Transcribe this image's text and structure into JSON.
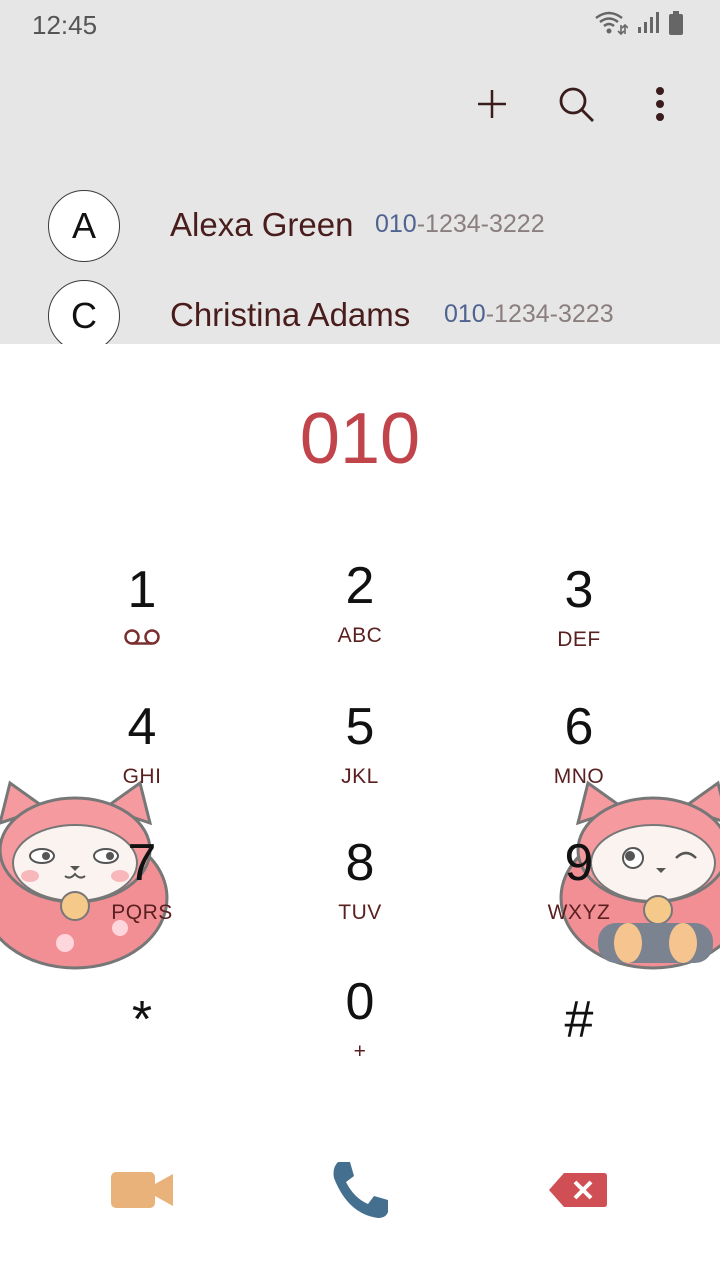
{
  "status_bar": {
    "time": "12:45"
  },
  "contacts": [
    {
      "initial": "A",
      "name": "Alexa Green",
      "number_match": "010",
      "number_rest": "-1234-3222"
    },
    {
      "initial": "C",
      "name": "Christina Adams",
      "number_match": "010",
      "number_rest": "-1234-3223"
    }
  ],
  "dialed_number": "010",
  "keypad": [
    {
      "digit": "1",
      "letters": ""
    },
    {
      "digit": "2",
      "letters": "ABC"
    },
    {
      "digit": "3",
      "letters": "DEF"
    },
    {
      "digit": "4",
      "letters": "GHI"
    },
    {
      "digit": "5",
      "letters": "JKL"
    },
    {
      "digit": "6",
      "letters": "MNO"
    },
    {
      "digit": "7",
      "letters": "PQRS"
    },
    {
      "digit": "8",
      "letters": "TUV"
    },
    {
      "digit": "9",
      "letters": "WXYZ"
    },
    {
      "digit": "*",
      "letters": ""
    },
    {
      "digit": "0",
      "letters": "+"
    },
    {
      "digit": "#",
      "letters": ""
    }
  ],
  "icons": {
    "actions": [
      "add-icon",
      "search-icon",
      "more-options-icon"
    ],
    "voicemail": "voicemail-icon",
    "bottom": [
      "video-call-icon",
      "phone-call-icon",
      "backspace-icon"
    ]
  },
  "colors": {
    "dialed_number": "#c0444a",
    "number_match": "#4e6390",
    "video": "#e8b27a",
    "call": "#456f8e",
    "backspace": "#cf4f54"
  }
}
